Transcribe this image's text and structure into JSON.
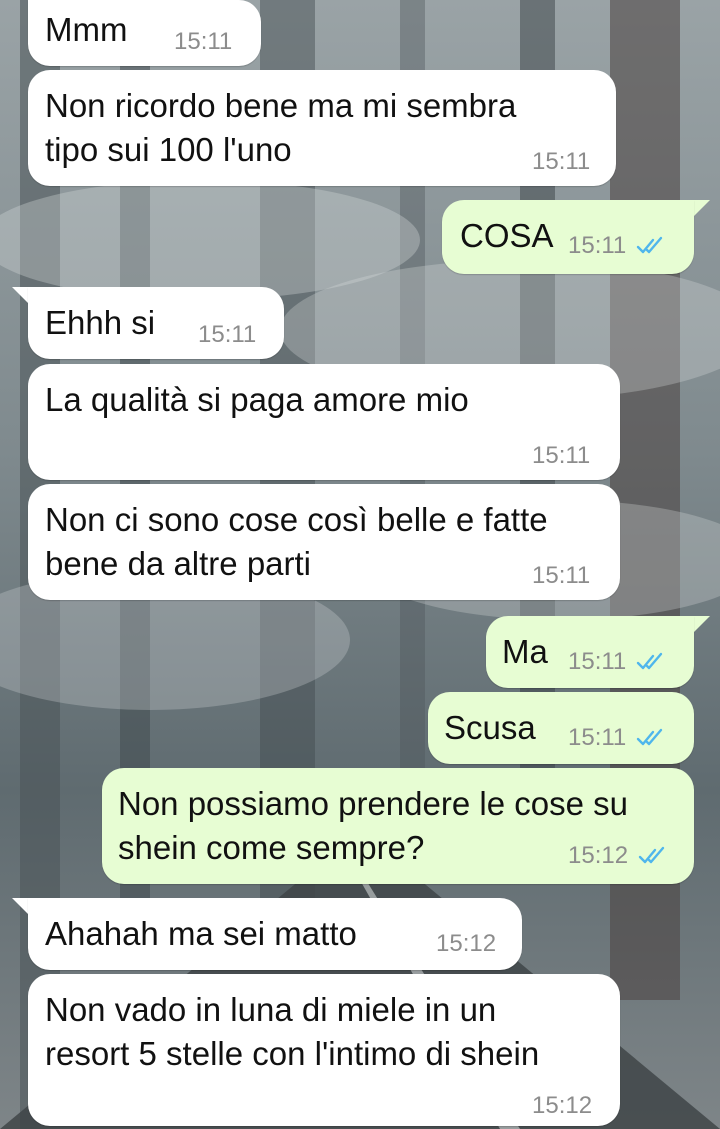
{
  "messages": [
    {
      "direction": "in",
      "text": "Mmm",
      "time": "15:11"
    },
    {
      "direction": "in",
      "text": "Non ricordo bene ma mi sembra\ntipo sui 100 l'uno",
      "time": "15:11"
    },
    {
      "direction": "out",
      "text": "COSA",
      "time": "15:11",
      "status": "read"
    },
    {
      "direction": "in",
      "text": "Ehhh si",
      "time": "15:11"
    },
    {
      "direction": "in",
      "text": "La qualità si paga amore mio",
      "time": "15:11"
    },
    {
      "direction": "in",
      "text": "Non ci sono cose così belle e fatte\nbene da altre parti",
      "time": "15:11"
    },
    {
      "direction": "out",
      "text": "Ma",
      "time": "15:11",
      "status": "read"
    },
    {
      "direction": "out",
      "text": "Scusa",
      "time": "15:11",
      "status": "read"
    },
    {
      "direction": "out",
      "text": "Non possiamo prendere le cose su\nshein come sempre?",
      "time": "15:12",
      "status": "read"
    },
    {
      "direction": "in",
      "text": "Ahahah ma sei matto",
      "time": "15:12"
    },
    {
      "direction": "in",
      "text": "Non vado in luna di miele in un\nresort 5 stelle con l'intimo di shein",
      "time": "15:12"
    }
  ],
  "colors": {
    "incoming_bubble": "#ffffff",
    "outgoing_bubble": "#e7fdd3",
    "timestamp": "#8c8c8c",
    "read_tick": "#4fb6ec"
  },
  "icons": {
    "read_status": "double-check-icon",
    "wallpaper": "snowy-forest-road-wallpaper"
  }
}
